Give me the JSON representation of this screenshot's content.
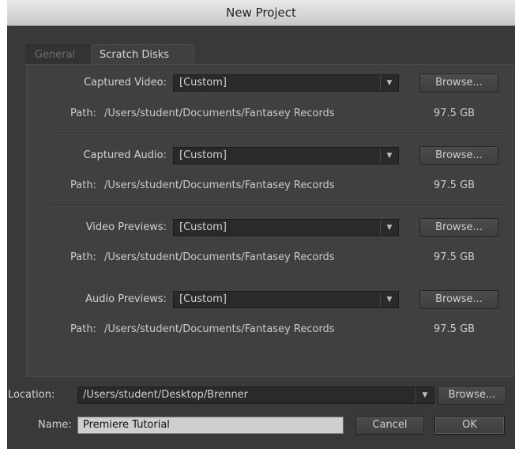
{
  "window": {
    "title": "New Project"
  },
  "tabs": [
    {
      "label": "General",
      "active": false
    },
    {
      "label": "Scratch Disks",
      "active": true
    }
  ],
  "scratch_disks": [
    {
      "label": "Captured Video:",
      "value": "[Custom]",
      "browse_label": "Browse...",
      "path_label": "Path:",
      "path": "/Users/student/Documents/Fantasey Records",
      "size": "97.5 GB"
    },
    {
      "label": "Captured Audio:",
      "value": "[Custom]",
      "browse_label": "Browse...",
      "path_label": "Path:",
      "path": "/Users/student/Documents/Fantasey Records",
      "size": "97.5 GB"
    },
    {
      "label": "Video Previews:",
      "value": "[Custom]",
      "browse_label": "Browse...",
      "path_label": "Path:",
      "path": "/Users/student/Documents/Fantasey Records",
      "size": "97.5 GB"
    },
    {
      "label": "Audio Previews:",
      "value": "[Custom]",
      "browse_label": "Browse...",
      "path_label": "Path:",
      "path": "/Users/student/Documents/Fantasey Records",
      "size": "97.5 GB"
    }
  ],
  "location": {
    "label": "Location:",
    "value": "/Users/student/Desktop/Brenner",
    "browse_label": "Browse..."
  },
  "name": {
    "label": "Name:",
    "value": "Premiere Tutorial"
  },
  "buttons": {
    "cancel": "Cancel",
    "ok": "OK"
  },
  "icons": {
    "dropdown_arrow": "chevron-down-icon"
  }
}
